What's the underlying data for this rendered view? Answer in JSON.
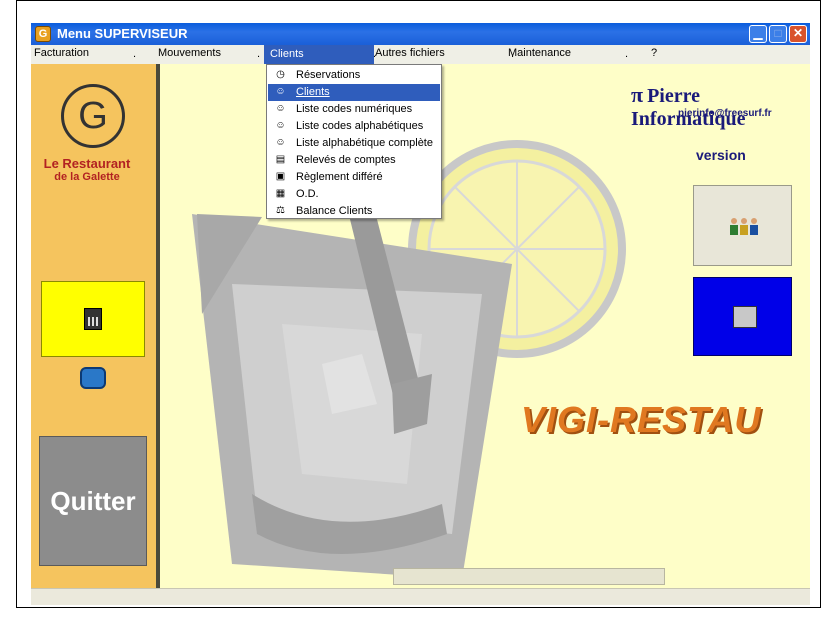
{
  "window": {
    "title": "Menu  SUPERVISEUR",
    "app_icon_letter": "G",
    "minimize": "▁",
    "maximize": "□",
    "close": "✕"
  },
  "menubar": {
    "items": [
      {
        "label": "Facturation"
      },
      {
        "label": "Mouvements"
      },
      {
        "label": "Clients"
      },
      {
        "label": "Autres fichiers"
      },
      {
        "label": "Maintenance"
      },
      {
        "label": "?"
      }
    ],
    "separator": "."
  },
  "clients_menu": {
    "items": [
      {
        "label": "Réservations",
        "icon": "clock-icon",
        "glyph": "◷"
      },
      {
        "label": "Clients",
        "icon": "users-icon",
        "glyph": "☺"
      },
      {
        "label": "Liste codes numériques",
        "icon": "list-people-icon",
        "glyph": "☺"
      },
      {
        "label": "Liste codes alphabétiques",
        "icon": "list-people-icon",
        "glyph": "☺"
      },
      {
        "label": "Liste alphabétique complète",
        "icon": "list-people-icon",
        "glyph": "☺"
      },
      {
        "label": "Relevés de comptes",
        "icon": "document-icon",
        "glyph": "▤"
      },
      {
        "label": "Règlement différé",
        "icon": "payment-icon",
        "glyph": "▣"
      },
      {
        "label": "O.D.",
        "icon": "ledger-icon",
        "glyph": "▦"
      },
      {
        "label": "Balance Clients",
        "icon": "balance-icon",
        "glyph": "⚖"
      }
    ]
  },
  "sidebar": {
    "logo_letter": "G",
    "logo_line1": "Le Restaurant",
    "logo_line2": "de la Galette",
    "quit_label": "Quitter"
  },
  "brand": {
    "pi": "π",
    "name": "Pierre Informatique",
    "email": "pierinfo@freesurf.fr",
    "version": "version"
  },
  "app_name": "VIGI-RESTAU",
  "colors": {
    "background": "#fefec8",
    "sidebar": "#f5c45e",
    "calc_button": "#ffff00",
    "blue_button": "#0000e8",
    "accent_text": "#e07820",
    "brand_text": "#1a1a7a",
    "menu_highlight": "#2f5dbc"
  }
}
